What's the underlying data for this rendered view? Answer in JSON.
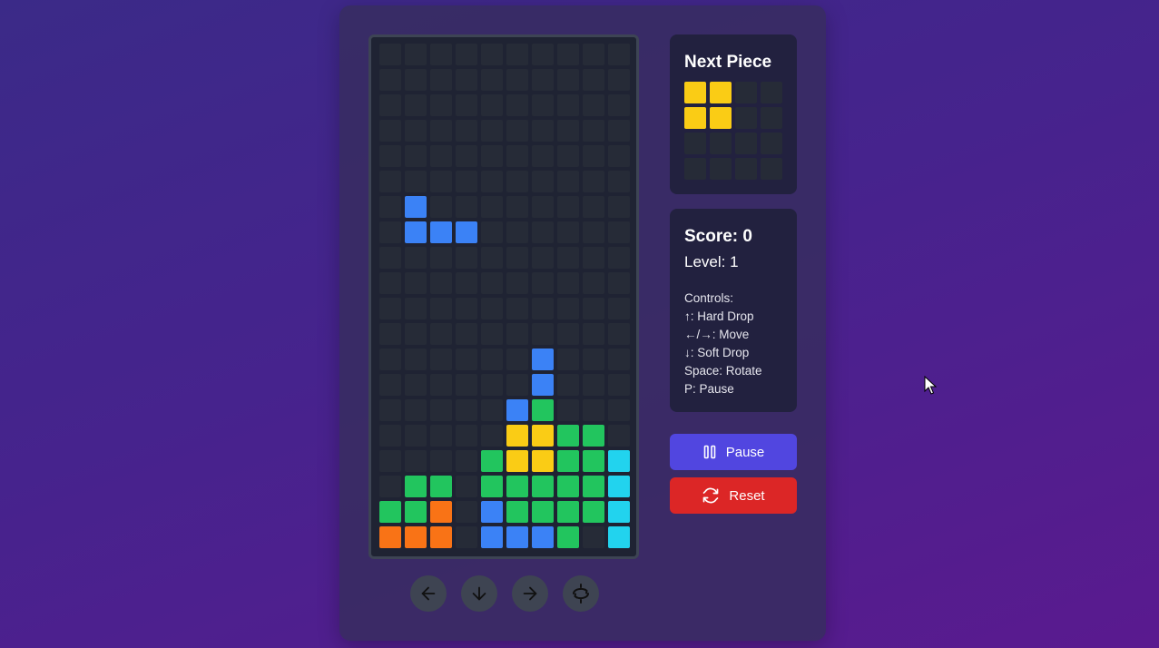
{
  "next_piece": {
    "title": "Next Piece",
    "cells": [
      [
        1,
        1,
        0,
        0
      ],
      [
        1,
        1,
        0,
        0
      ],
      [
        0,
        0,
        0,
        0
      ],
      [
        0,
        0,
        0,
        0
      ]
    ],
    "color": "#facc15"
  },
  "stats": {
    "score_label": "Score: 0",
    "level_label": "Level: 1",
    "controls": [
      "Controls:",
      "↑: Hard Drop",
      "←/→: Move",
      "↓: Soft Drop",
      "Space: Rotate",
      "P: Pause"
    ]
  },
  "buttons": {
    "pause_label": "Pause",
    "reset_label": "Reset"
  },
  "mobile_controls": [
    "arrow-left-icon",
    "arrow-down-icon",
    "arrow-right-icon",
    "rotate-icon"
  ],
  "colors": {
    "empty": "#262b37",
    "B": "#3b82f6",
    "Y": "#facc15",
    "G": "#22c55e",
    "O": "#f97316",
    "C": "#22d3ee"
  },
  "board": {
    "rows": [
      "..........",
      "..........",
      "..........",
      "..........",
      "..........",
      "..........",
      ".B........",
      ".BBB......",
      "..........",
      "..........",
      "..........",
      "..........",
      "......B...",
      "......B...",
      ".....BG...",
      ".....YYGG.",
      "....GYYGGC",
      ".GG.GGGGGC",
      "GGO.BGGGGC",
      "OOO.BBBG.C"
    ]
  }
}
